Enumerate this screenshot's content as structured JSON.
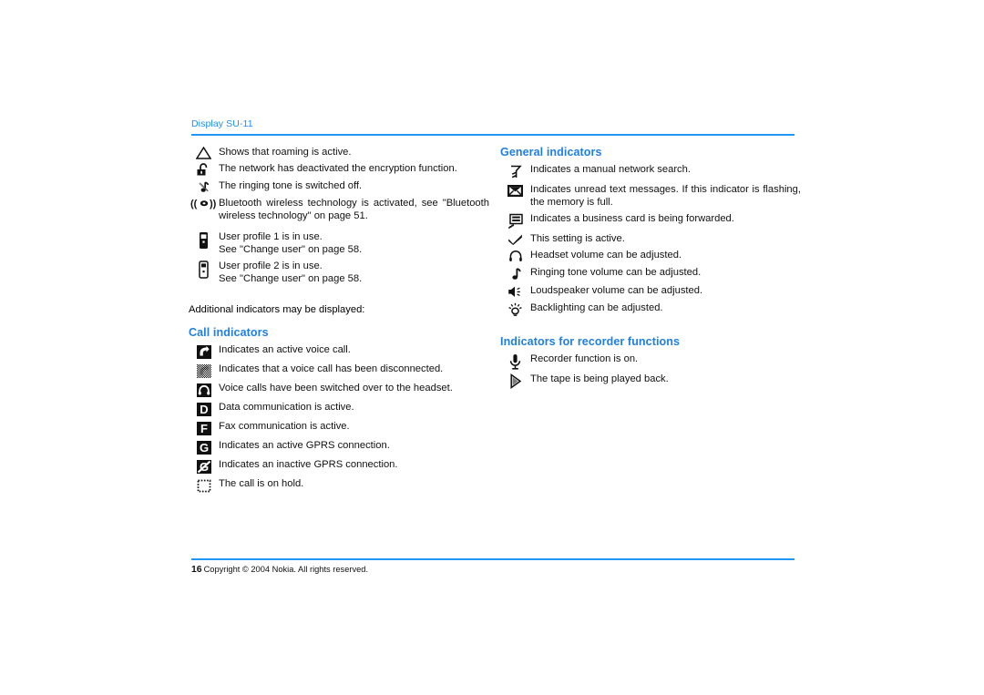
{
  "page": {
    "running_head": "Display SU-11",
    "accent_color": "#2196f3",
    "heading_color": "#1f7fe0",
    "page_number": "16",
    "copyright": "Copyright © 2004 Nokia. All rights reserved."
  },
  "left_column": {
    "top_indicators": [
      {
        "icon": "triangle-roaming-icon",
        "text": "Shows that roaming is active."
      },
      {
        "icon": "open-padlock-icon",
        "text": "The network has deactivated the encryption function."
      },
      {
        "icon": "crossed-note-icon",
        "text": "The ringing tone is switched off."
      },
      {
        "icon": "bluetooth-antenna-icon",
        "text": "Bluetooth wireless technology is activated, see \"Bluetooth wireless technology\" on page 51.",
        "justify": true
      },
      {
        "icon": "user-profile-1-icon",
        "text": "User profile 1 is in use.",
        "text_line2": "See \"Change user\" on page 58."
      },
      {
        "icon": "user-profile-2-icon",
        "text": "User profile 2 is in use.",
        "text_line2": "See \"Change user\" on page 58."
      }
    ],
    "additional_note": "Additional indicators may be displayed:",
    "call_section": {
      "heading": "Call indicators",
      "items": [
        {
          "icon": "active-voice-call-icon",
          "text": "Indicates an active voice call."
        },
        {
          "icon": "disconnected-call-icon",
          "text": "Indicates that a voice call has been disconnected."
        },
        {
          "icon": "headset-call-icon",
          "text": "Voice calls have been switched over to the headset."
        },
        {
          "icon": "data-communication-icon",
          "text": "Data communication is active."
        },
        {
          "icon": "fax-communication-icon",
          "text": "Fax communication is active."
        },
        {
          "icon": "gprs-active-icon",
          "text": "Indicates an active GPRS connection."
        },
        {
          "icon": "gprs-inactive-icon",
          "text": "Indicates an inactive GPRS connection."
        },
        {
          "icon": "call-on-hold-icon",
          "text": "The call is on hold."
        }
      ]
    }
  },
  "right_column": {
    "general_section": {
      "heading": "General indicators",
      "items": [
        {
          "icon": "manual-network-search-icon",
          "text": "Indicates a manual network search."
        },
        {
          "icon": "unread-message-icon",
          "text": "Indicates unread text messages. If this indicator is flashing, the memory is full.",
          "justify": true
        },
        {
          "icon": "business-card-forward-icon",
          "text": "Indicates a business card is being forwarded."
        },
        {
          "icon": "checkmark-icon",
          "text": "This setting is active."
        },
        {
          "icon": "headset-volume-icon",
          "text": "Headset volume can be adjusted."
        },
        {
          "icon": "ringing-tone-volume-icon",
          "text": "Ringing tone volume can be adjusted."
        },
        {
          "icon": "loudspeaker-volume-icon",
          "text": "Loudspeaker volume can be adjusted."
        },
        {
          "icon": "backlighting-icon",
          "text": "Backlighting can be adjusted."
        }
      ]
    },
    "recorder_section": {
      "heading": "Indicators for recorder functions",
      "items": [
        {
          "icon": "microphone-recorder-icon",
          "text": "Recorder function is on."
        },
        {
          "icon": "play-tape-icon",
          "text": "The tape is being played back."
        }
      ]
    }
  }
}
